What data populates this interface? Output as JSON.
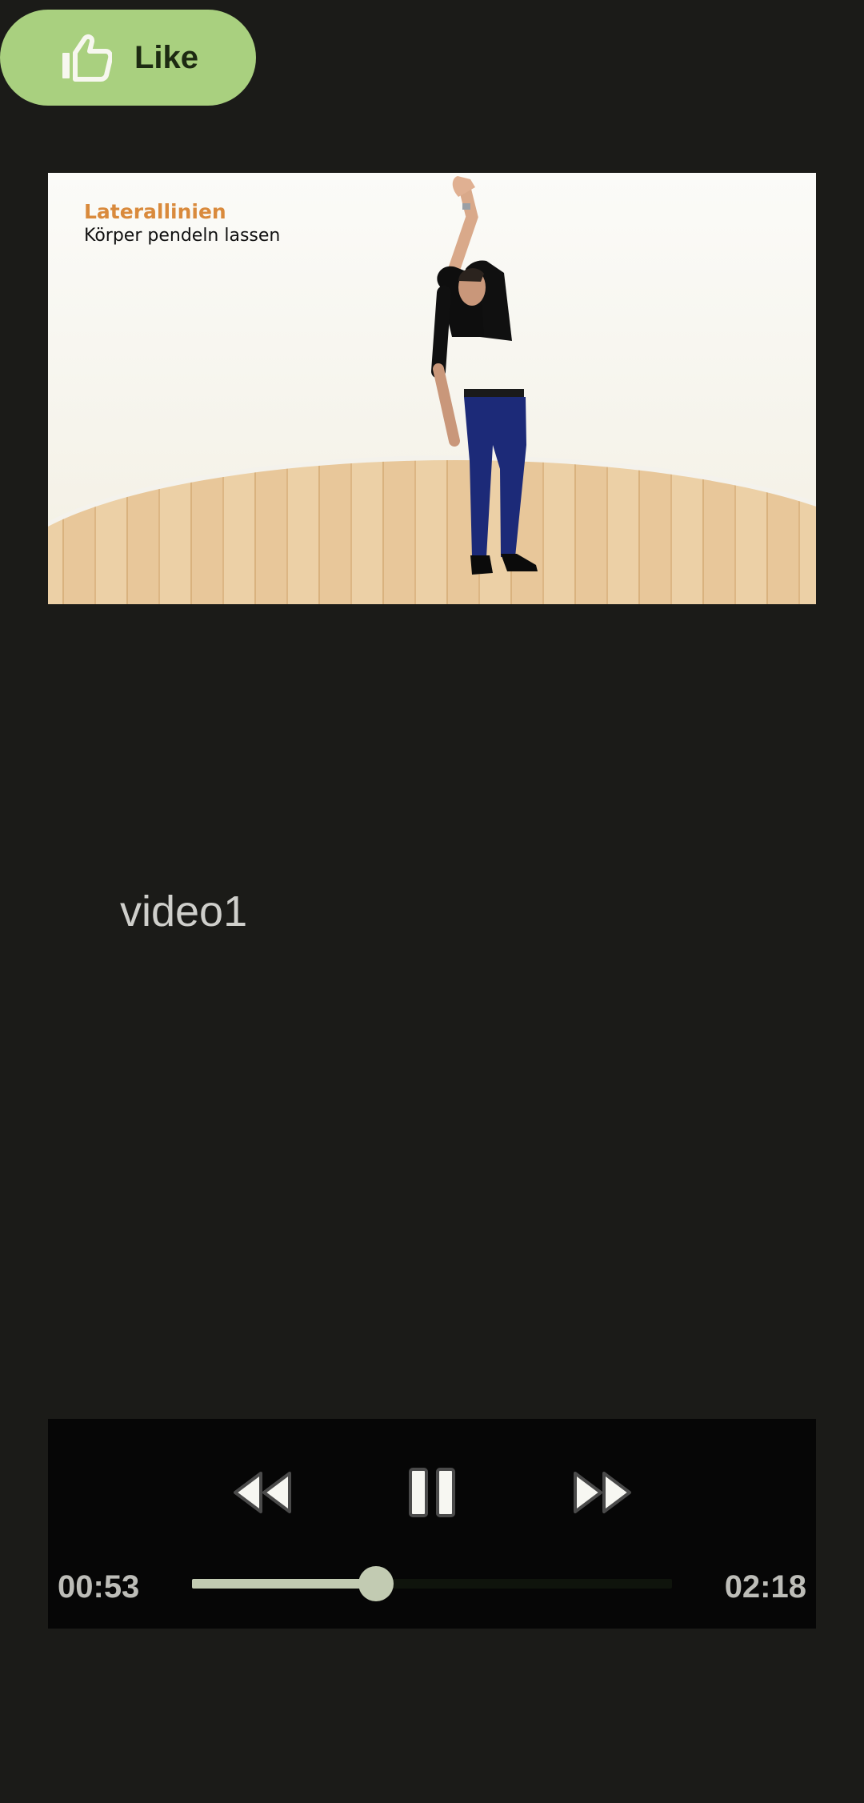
{
  "like_button": {
    "label": "Like",
    "icon": "thumbs-up-icon"
  },
  "video": {
    "caption_title": "Laterallinien",
    "caption_subtitle": "Körper pendeln lassen"
  },
  "title": "video1",
  "player": {
    "current_time": "00:53",
    "duration": "02:18",
    "progress_fraction": 0.384,
    "controls": {
      "rewind_icon": "rewind-icon",
      "pause_icon": "pause-icon",
      "fast_forward_icon": "fast-forward-icon"
    }
  },
  "colors": {
    "background": "#1b1b18",
    "like_button": "#a9d07f",
    "controls_bg": "#060606",
    "seek_fill": "#c2cbb2",
    "caption_accent": "#d98a3c"
  }
}
